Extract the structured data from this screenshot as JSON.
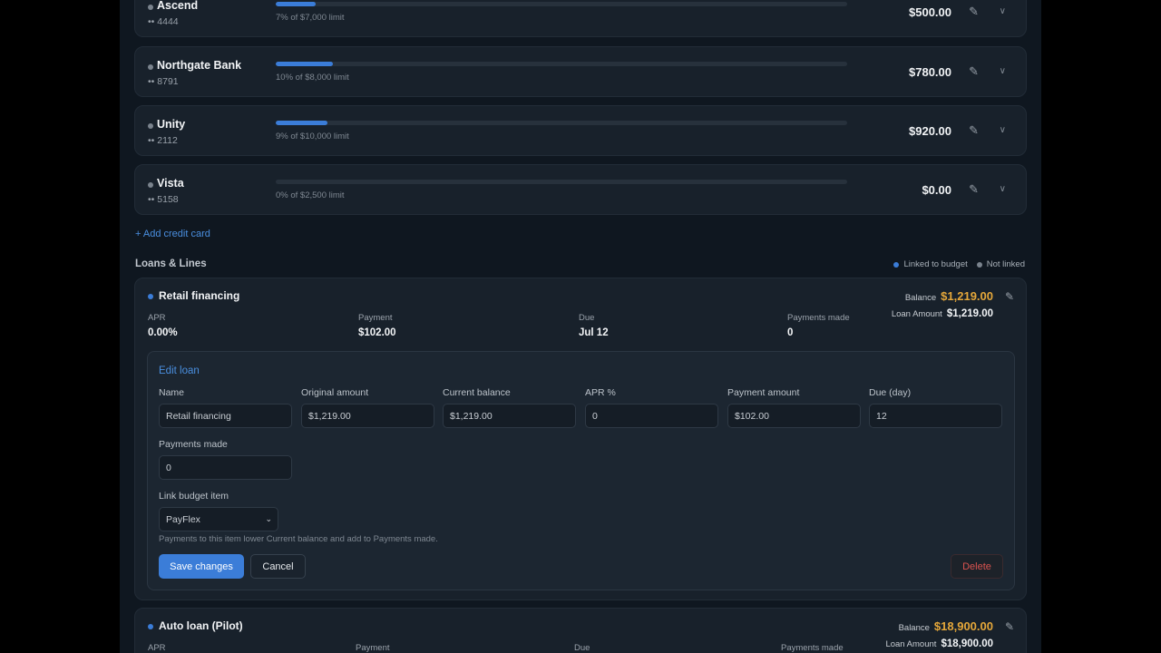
{
  "credit_cards": [
    {
      "name": "Ascend",
      "mask": "•• 4444",
      "limit_text": "7% of $7,000 limit",
      "utilization": 0.07,
      "amount": "$500.00"
    },
    {
      "name": "Northgate Bank",
      "mask": "•• 8791",
      "limit_text": "10% of $8,000 limit",
      "utilization": 0.1,
      "amount": "$780.00"
    },
    {
      "name": "Unity",
      "mask": "•• 2112",
      "limit_text": "9% of $10,000 limit",
      "utilization": 0.09,
      "amount": "$920.00"
    },
    {
      "name": "Vista",
      "mask": "•• 5158",
      "limit_text": "0% of $2,500 limit",
      "utilization": 0.0,
      "amount": "$0.00"
    }
  ],
  "icons": {
    "edit": "pencil-icon",
    "expand": "chevron-down-icon"
  },
  "add_card_label": "+ Add credit card",
  "loans_section": {
    "title": "Loans & Lines",
    "legend": {
      "linked": "Linked to budget",
      "not_linked": "Not linked",
      "linked_color": "#3b7dd8",
      "not_linked_color": "#7a838d"
    }
  },
  "loans": [
    {
      "name": "Retail financing",
      "balance_label": "Balance",
      "balance": "$1,219.00",
      "loan_amount_label": "Loan Amount",
      "loan_amount": "$1,219.00",
      "stats": [
        {
          "label": "APR",
          "value": "0.00%"
        },
        {
          "label": "Payment",
          "value": "$102.00"
        },
        {
          "label": "Due",
          "value": "Jul 12"
        },
        {
          "label": "Payments made",
          "value": "0"
        }
      ]
    },
    {
      "name": "Auto loan (Pilot)",
      "balance_label": "Balance",
      "balance": "$18,900.00",
      "loan_amount_label": "Loan Amount",
      "loan_amount": "$18,900.00",
      "stats": [
        {
          "label": "APR",
          "value": ""
        },
        {
          "label": "Payment",
          "value": ""
        },
        {
          "label": "Due",
          "value": ""
        },
        {
          "label": "Payments made",
          "value": ""
        }
      ]
    }
  ],
  "edit_loan": {
    "title": "Edit loan",
    "fields": [
      {
        "label": "Name",
        "value": "Retail financing"
      },
      {
        "label": "Original amount",
        "value": "$1,219.00"
      },
      {
        "label": "Current balance",
        "value": "$1,219.00"
      },
      {
        "label": "APR %",
        "value": "0"
      },
      {
        "label": "Payment amount",
        "value": "$102.00"
      },
      {
        "label": "Due (day)",
        "value": "12"
      }
    ],
    "payments_made": {
      "label": "Payments made",
      "value": "0"
    },
    "link_budget": {
      "label": "Link budget item",
      "selected": "PayFlex"
    },
    "hint": "Payments to this item lower Current balance and add to Payments made.",
    "save_label": "Save changes",
    "cancel_label": "Cancel",
    "delete_label": "Delete"
  }
}
